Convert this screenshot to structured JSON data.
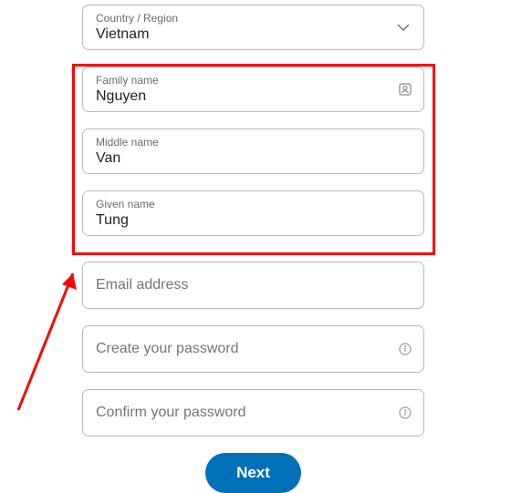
{
  "country": {
    "label": "Country / Region",
    "value": "Vietnam"
  },
  "family": {
    "label": "Family name",
    "value": "Nguyen"
  },
  "middle": {
    "label": "Middle name",
    "value": "Van"
  },
  "given": {
    "label": "Given name",
    "value": "Tung"
  },
  "email": {
    "placeholder": "Email address"
  },
  "pass1": {
    "placeholder": "Create your password"
  },
  "pass2": {
    "placeholder": "Confirm your password"
  },
  "next": {
    "label": "Next"
  }
}
